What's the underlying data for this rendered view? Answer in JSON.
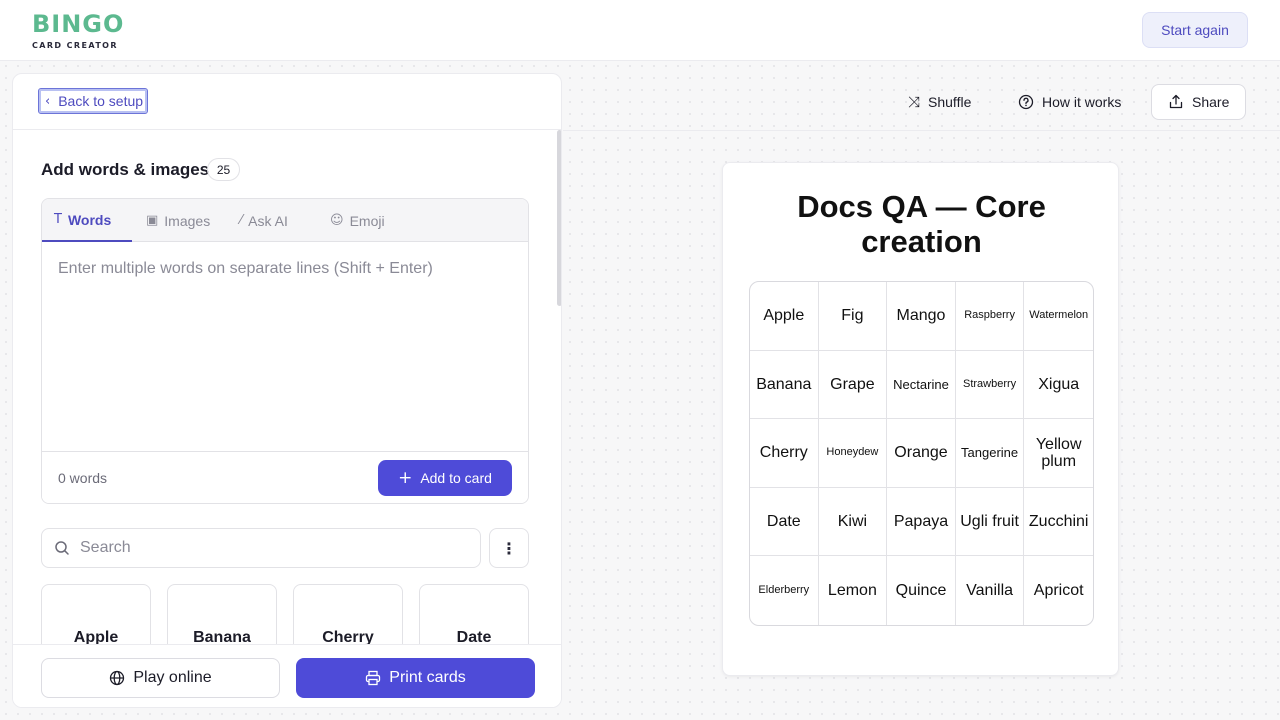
{
  "header": {
    "logo_word": "BINGO",
    "logo_sub": "CARD CREATOR",
    "start_again": "Start again"
  },
  "panel": {
    "back_label": "Back to setup",
    "section_title": "Add words & images",
    "count": "25",
    "tabs": [
      {
        "label": "Words",
        "icon": "text-icon",
        "active": true
      },
      {
        "label": "Images",
        "icon": "image-icon",
        "active": false
      },
      {
        "label": "Ask AI",
        "icon": "magic-wand-icon",
        "active": false
      },
      {
        "label": "Emoji",
        "icon": "smiley-icon",
        "active": false
      }
    ],
    "editor_placeholder": "Enter multiple words on separate lines (Shift + Enter)",
    "word_count": "0 words",
    "add_button": "Add to card",
    "search_placeholder": "Search",
    "word_cards": [
      "Apple",
      "Banana",
      "Cherry",
      "Date"
    ],
    "play_online": "Play online",
    "print_cards": "Print cards"
  },
  "toolbar": {
    "shuffle": "Shuffle",
    "how_it_works": "How it works",
    "share": "Share"
  },
  "card": {
    "title": "Docs QA — Core creation",
    "cells": [
      "Apple",
      "Fig",
      "Mango",
      "Raspberry",
      "Watermelon",
      "Banana",
      "Grape",
      "Nectarine",
      "Strawberry",
      "Xigua",
      "Cherry",
      "Honeydew",
      "Orange",
      "Tangerine",
      "Yellow plum",
      "Date",
      "Kiwi",
      "Papaya",
      "Ugli fruit",
      "Zucchini",
      "Elderberry",
      "Lemon",
      "Quince",
      "Vanilla",
      "Apricot"
    ]
  },
  "colors": {
    "accent": "#4e4bd8",
    "logo_green": "#5cb98f"
  }
}
